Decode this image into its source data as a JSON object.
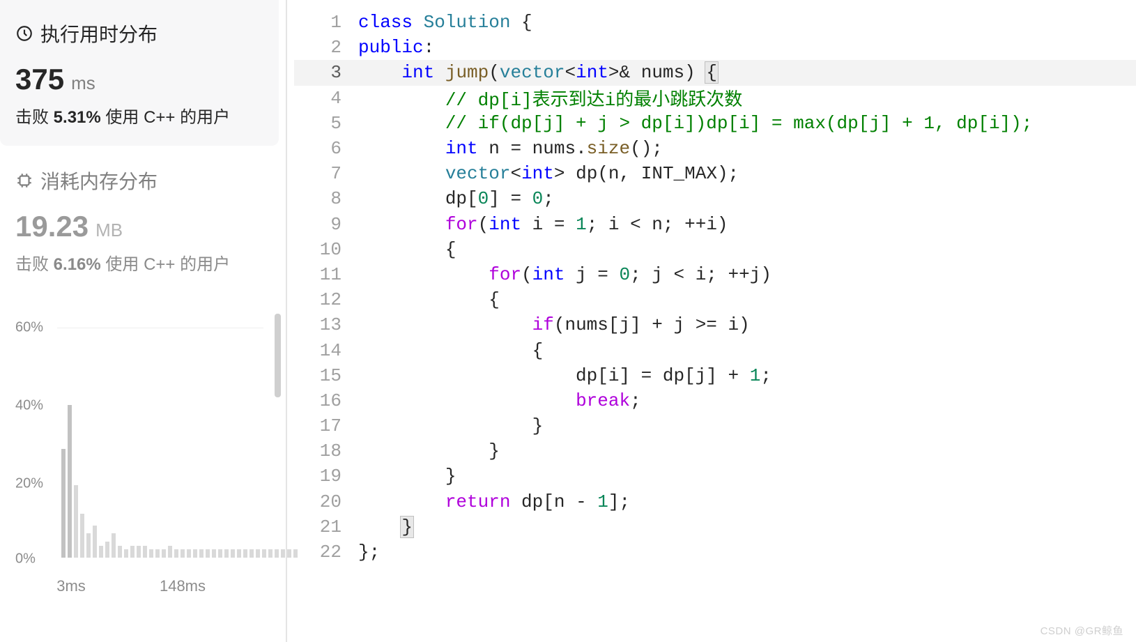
{
  "runtime": {
    "title": "执行用时分布",
    "value": "375",
    "unit": "ms",
    "beats_prefix": "击败 ",
    "beats_pct": "5.31%",
    "beats_suffix": " 使用 C++ 的用户"
  },
  "memory": {
    "title": "消耗内存分布",
    "value": "19.23",
    "unit": "MB",
    "beats_prefix": "击败 ",
    "beats_pct": "6.16%",
    "beats_suffix": " 使用 C++ 的用户"
  },
  "chart_data": {
    "type": "bar",
    "title": "",
    "xlabel": "",
    "ylabel": "",
    "ylim": [
      0,
      60
    ],
    "y_ticks": [
      "60%",
      "40%",
      "20%",
      "0%"
    ],
    "x_ticks": [
      "3ms",
      "148ms"
    ],
    "categories_note": "bars are unlabeled histogram bins between ~3ms and ~290ms",
    "values": [
      27,
      38,
      18,
      11,
      6,
      8,
      3,
      4,
      6,
      3,
      2,
      3,
      3,
      3,
      2,
      2,
      2,
      3,
      2,
      2,
      2,
      2,
      2,
      2,
      2,
      2,
      2,
      2,
      2,
      2,
      2,
      2,
      2,
      2,
      2,
      2,
      2,
      2
    ]
  },
  "code": {
    "lines": [
      {
        "n": "1",
        "tokens": [
          {
            "c": "tok-kw",
            "t": "class"
          },
          {
            "t": " "
          },
          {
            "c": "tok-type",
            "t": "Solution"
          },
          {
            "t": " {"
          }
        ]
      },
      {
        "n": "2",
        "tokens": [
          {
            "c": "tok-kw",
            "t": "public"
          },
          {
            "t": ":"
          }
        ]
      },
      {
        "n": "3",
        "active": true,
        "tokens": [
          {
            "t": "    "
          },
          {
            "c": "tok-type2",
            "t": "int"
          },
          {
            "t": " "
          },
          {
            "c": "tok-fn",
            "t": "jump"
          },
          {
            "t": "("
          },
          {
            "c": "tok-type",
            "t": "vector"
          },
          {
            "t": "<"
          },
          {
            "c": "tok-type2",
            "t": "int"
          },
          {
            "t": ">& nums) "
          },
          {
            "c": "bracket-hl",
            "t": "{"
          }
        ]
      },
      {
        "n": "4",
        "tokens": [
          {
            "t": "        "
          },
          {
            "c": "tok-comment",
            "t": "// dp[i]表示到达i的最小跳跃次数"
          }
        ]
      },
      {
        "n": "5",
        "tokens": [
          {
            "t": "        "
          },
          {
            "c": "tok-comment",
            "t": "// if(dp[j] + j > dp[i])dp[i] = max(dp[j] + 1, dp[i]);"
          }
        ]
      },
      {
        "n": "6",
        "tokens": [
          {
            "t": "        "
          },
          {
            "c": "tok-type2",
            "t": "int"
          },
          {
            "t": " n = nums."
          },
          {
            "c": "tok-builtin",
            "t": "size"
          },
          {
            "t": "();"
          }
        ]
      },
      {
        "n": "7",
        "tokens": [
          {
            "t": "        "
          },
          {
            "c": "tok-type",
            "t": "vector"
          },
          {
            "t": "<"
          },
          {
            "c": "tok-type2",
            "t": "int"
          },
          {
            "t": "> "
          },
          {
            "c": "",
            "t": "dp"
          },
          {
            "t": "(n, "
          },
          {
            "c": "tok-const",
            "t": "INT_MAX"
          },
          {
            "t": ");"
          }
        ]
      },
      {
        "n": "8",
        "tokens": [
          {
            "t": "        dp["
          },
          {
            "c": "tok-num",
            "t": "0"
          },
          {
            "t": "] = "
          },
          {
            "c": "tok-num",
            "t": "0"
          },
          {
            "t": ";"
          }
        ]
      },
      {
        "n": "9",
        "tokens": [
          {
            "t": "        "
          },
          {
            "c": "tok-ctrl",
            "t": "for"
          },
          {
            "t": "("
          },
          {
            "c": "tok-type2",
            "t": "int"
          },
          {
            "t": " i = "
          },
          {
            "c": "tok-num",
            "t": "1"
          },
          {
            "t": "; i < n; ++i)"
          }
        ]
      },
      {
        "n": "10",
        "tokens": [
          {
            "t": "        {"
          }
        ]
      },
      {
        "n": "11",
        "tokens": [
          {
            "t": "            "
          },
          {
            "c": "tok-ctrl",
            "t": "for"
          },
          {
            "t": "("
          },
          {
            "c": "tok-type2",
            "t": "int"
          },
          {
            "t": " j = "
          },
          {
            "c": "tok-num",
            "t": "0"
          },
          {
            "t": "; j < i; ++j)"
          }
        ]
      },
      {
        "n": "12",
        "tokens": [
          {
            "t": "            {"
          }
        ]
      },
      {
        "n": "13",
        "tokens": [
          {
            "t": "                "
          },
          {
            "c": "tok-ctrl",
            "t": "if"
          },
          {
            "t": "(nums[j] + j >= i)"
          }
        ]
      },
      {
        "n": "14",
        "tokens": [
          {
            "t": "                {"
          }
        ]
      },
      {
        "n": "15",
        "tokens": [
          {
            "t": "                    dp[i] = dp[j] + "
          },
          {
            "c": "tok-num",
            "t": "1"
          },
          {
            "t": ";"
          }
        ]
      },
      {
        "n": "16",
        "tokens": [
          {
            "t": "                    "
          },
          {
            "c": "tok-ctrl",
            "t": "break"
          },
          {
            "t": ";"
          }
        ]
      },
      {
        "n": "17",
        "tokens": [
          {
            "t": "                }"
          }
        ]
      },
      {
        "n": "18",
        "tokens": [
          {
            "t": "            }"
          }
        ]
      },
      {
        "n": "19",
        "tokens": [
          {
            "t": "        }"
          }
        ]
      },
      {
        "n": "20",
        "tokens": [
          {
            "t": "        "
          },
          {
            "c": "tok-ctrl",
            "t": "return"
          },
          {
            "t": " dp[n - "
          },
          {
            "c": "tok-num",
            "t": "1"
          },
          {
            "t": "];"
          }
        ]
      },
      {
        "n": "21",
        "tokens": [
          {
            "t": "    "
          },
          {
            "c": "bracket-hl",
            "t": "}"
          }
        ]
      },
      {
        "n": "22",
        "tokens": [
          {
            "t": "};"
          }
        ]
      }
    ]
  },
  "watermark": "CSDN @GR鲸鱼"
}
